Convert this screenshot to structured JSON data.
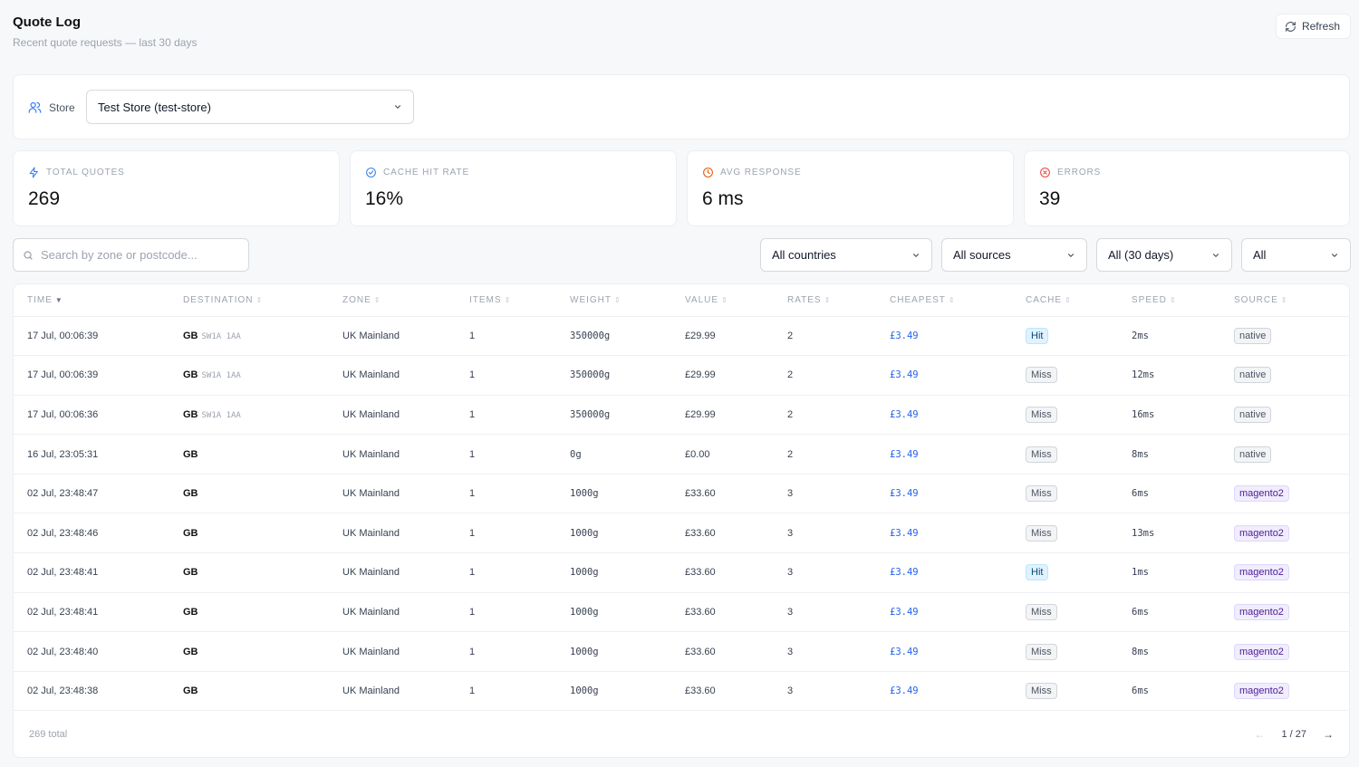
{
  "header": {
    "title": "Quote Log",
    "subtitle": "Recent quote requests — last 30 days",
    "refresh_label": "Refresh"
  },
  "store": {
    "label": "Store",
    "selected": "Test Store (test-store)"
  },
  "stats": [
    {
      "label": "TOTAL QUOTES",
      "value": "269",
      "icon": "lightning-icon",
      "color": "#3b82f6"
    },
    {
      "label": "CACHE HIT RATE",
      "value": "16%",
      "icon": "check-circle-icon",
      "color": "#3b82f6"
    },
    {
      "label": "AVG RESPONSE",
      "value": "6 ms",
      "icon": "clock-icon",
      "color": "#ea580c"
    },
    {
      "label": "ERRORS",
      "value": "39",
      "icon": "x-circle-icon",
      "color": "#ef4444"
    }
  ],
  "search": {
    "placeholder": "Search by zone or postcode..."
  },
  "filters": {
    "country": "All countries",
    "source": "All sources",
    "period": "All (30 days)",
    "status": "All"
  },
  "table": {
    "columns": [
      "TIME",
      "DESTINATION",
      "ZONE",
      "ITEMS",
      "WEIGHT",
      "VALUE",
      "RATES",
      "CHEAPEST",
      "CACHE",
      "SPEED",
      "SOURCE"
    ],
    "rows": [
      {
        "time": "17 Jul, 00:06:39",
        "country": "GB",
        "postcode": "SW1A 1AA",
        "zone": "UK Mainland",
        "items": "1",
        "weight": "350000g",
        "value": "£29.99",
        "rates": "2",
        "cheapest": "£3.49",
        "cache": "Hit",
        "speed": "2ms",
        "source": "native"
      },
      {
        "time": "17 Jul, 00:06:39",
        "country": "GB",
        "postcode": "SW1A 1AA",
        "zone": "UK Mainland",
        "items": "1",
        "weight": "350000g",
        "value": "£29.99",
        "rates": "2",
        "cheapest": "£3.49",
        "cache": "Miss",
        "speed": "12ms",
        "source": "native"
      },
      {
        "time": "17 Jul, 00:06:36",
        "country": "GB",
        "postcode": "SW1A 1AA",
        "zone": "UK Mainland",
        "items": "1",
        "weight": "350000g",
        "value": "£29.99",
        "rates": "2",
        "cheapest": "£3.49",
        "cache": "Miss",
        "speed": "16ms",
        "source": "native"
      },
      {
        "time": "16 Jul, 23:05:31",
        "country": "GB",
        "postcode": "",
        "zone": "UK Mainland",
        "items": "1",
        "weight": "0g",
        "value": "£0.00",
        "rates": "2",
        "cheapest": "£3.49",
        "cache": "Miss",
        "speed": "8ms",
        "source": "native"
      },
      {
        "time": "02 Jul, 23:48:47",
        "country": "GB",
        "postcode": "",
        "zone": "UK Mainland",
        "items": "1",
        "weight": "1000g",
        "value": "£33.60",
        "rates": "3",
        "cheapest": "£3.49",
        "cache": "Miss",
        "speed": "6ms",
        "source": "magento2"
      },
      {
        "time": "02 Jul, 23:48:46",
        "country": "GB",
        "postcode": "",
        "zone": "UK Mainland",
        "items": "1",
        "weight": "1000g",
        "value": "£33.60",
        "rates": "3",
        "cheapest": "£3.49",
        "cache": "Miss",
        "speed": "13ms",
        "source": "magento2"
      },
      {
        "time": "02 Jul, 23:48:41",
        "country": "GB",
        "postcode": "",
        "zone": "UK Mainland",
        "items": "1",
        "weight": "1000g",
        "value": "£33.60",
        "rates": "3",
        "cheapest": "£3.49",
        "cache": "Hit",
        "speed": "1ms",
        "source": "magento2"
      },
      {
        "time": "02 Jul, 23:48:41",
        "country": "GB",
        "postcode": "",
        "zone": "UK Mainland",
        "items": "1",
        "weight": "1000g",
        "value": "£33.60",
        "rates": "3",
        "cheapest": "£3.49",
        "cache": "Miss",
        "speed": "6ms",
        "source": "magento2"
      },
      {
        "time": "02 Jul, 23:48:40",
        "country": "GB",
        "postcode": "",
        "zone": "UK Mainland",
        "items": "1",
        "weight": "1000g",
        "value": "£33.60",
        "rates": "3",
        "cheapest": "£3.49",
        "cache": "Miss",
        "speed": "8ms",
        "source": "magento2"
      },
      {
        "time": "02 Jul, 23:48:38",
        "country": "GB",
        "postcode": "",
        "zone": "UK Mainland",
        "items": "1",
        "weight": "1000g",
        "value": "£33.60",
        "rates": "3",
        "cheapest": "£3.49",
        "cache": "Miss",
        "speed": "6ms",
        "source": "magento2"
      }
    ]
  },
  "footer": {
    "total": "269 total",
    "page": "1 / 27"
  }
}
